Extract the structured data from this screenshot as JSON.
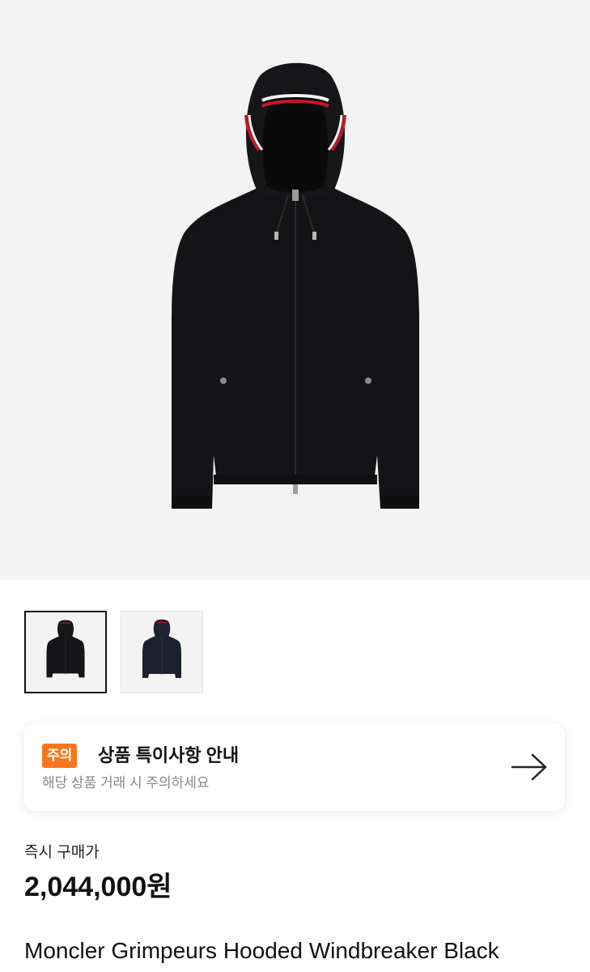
{
  "product": {
    "main_image": "product-photo-black-hooded-windbreaker",
    "thumbnails": [
      {
        "label": "black windbreaker front",
        "selected": true
      },
      {
        "label": "navy windbreaker front",
        "selected": false
      }
    ],
    "name": "Moncler Grimpeurs Hooded Windbreaker Black"
  },
  "notice": {
    "badge": "주의",
    "title": "상품 특이사항 안내",
    "subtitle": "해당 상품 거래 시 주의하세요",
    "icon": "arrow-right-icon"
  },
  "pricing": {
    "label": "즉시 구매가",
    "value": "2,044,000원"
  },
  "colors": {
    "badge": "#f7771e",
    "hero_background": "#f3f3f3",
    "text": "#111111",
    "subtext": "#888888"
  }
}
